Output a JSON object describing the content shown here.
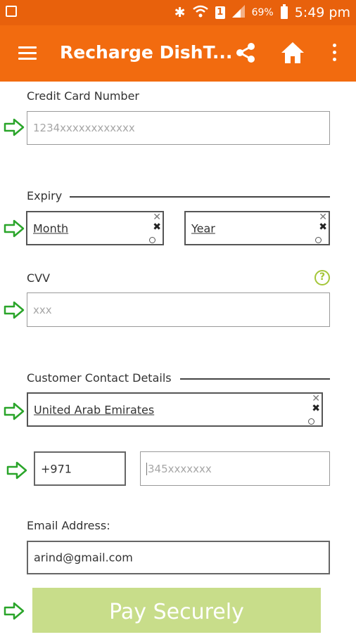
{
  "status_bar": {
    "battery_pct": "69%",
    "time": "5:49 pm",
    "sim_label": "1"
  },
  "app_bar": {
    "title": "Recharge DishT..."
  },
  "card_number": {
    "label": "Credit Card Number",
    "placeholder": "1234xxxxxxxxxxxx"
  },
  "expiry": {
    "label": "Expiry",
    "month": "Month",
    "year": "Year"
  },
  "cvv": {
    "label": "CVV",
    "placeholder": "xxx",
    "help_icon": "?"
  },
  "contact": {
    "label": "Customer Contact Details",
    "country": "United Arab Emirates",
    "dial_code": "+971",
    "phone_placeholder": "345xxxxxxx"
  },
  "email": {
    "label": "Email Address:",
    "value": "arind@gmail.com"
  },
  "pay_button": {
    "label": "Pay Securely"
  },
  "colors": {
    "app_bar": "#f26b0f",
    "status_bar": "#e8610c",
    "arrow": "#2aa52a",
    "pay_button": "#c8dd8a",
    "help_icon": "#a4c639"
  }
}
